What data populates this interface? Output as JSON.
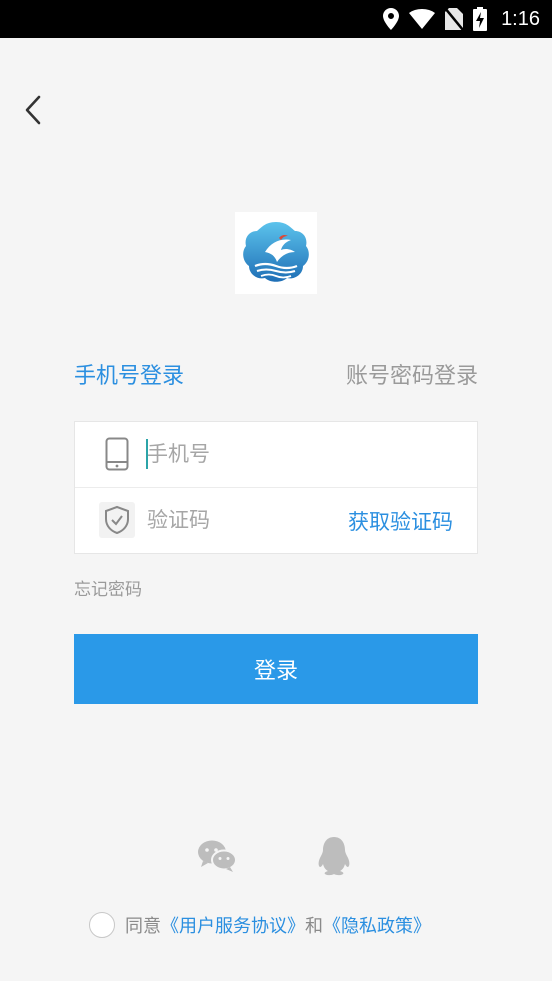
{
  "status_bar": {
    "time": "1:16",
    "icons": [
      "location-icon",
      "wifi-icon",
      "no-sim-icon",
      "battery-charging-icon"
    ]
  },
  "nav": {
    "back_icon": "chevron-left-icon"
  },
  "logo": {
    "icon": "app-logo"
  },
  "tabs": {
    "phone_login": "手机号登录",
    "account_login": "账号密码登录"
  },
  "form": {
    "phone": {
      "placeholder": "手机号",
      "value": "",
      "icon": "phone-icon"
    },
    "code": {
      "placeholder": "验证码",
      "value": "",
      "icon": "shield-check-icon",
      "get_code_label": "获取验证码"
    }
  },
  "forgot_password": "忘记密码",
  "login_button": "登录",
  "social": {
    "wechat_icon": "wechat-icon",
    "qq_icon": "qq-icon"
  },
  "agreement": {
    "prefix": "同意",
    "user_agreement": "《用户服务协议》",
    "and": "和",
    "privacy_policy": "《隐私政策》"
  },
  "colors": {
    "accent": "#2a99e8",
    "link": "#2b8fe0",
    "muted": "#9a9a9a",
    "background": "#f5f5f5"
  }
}
